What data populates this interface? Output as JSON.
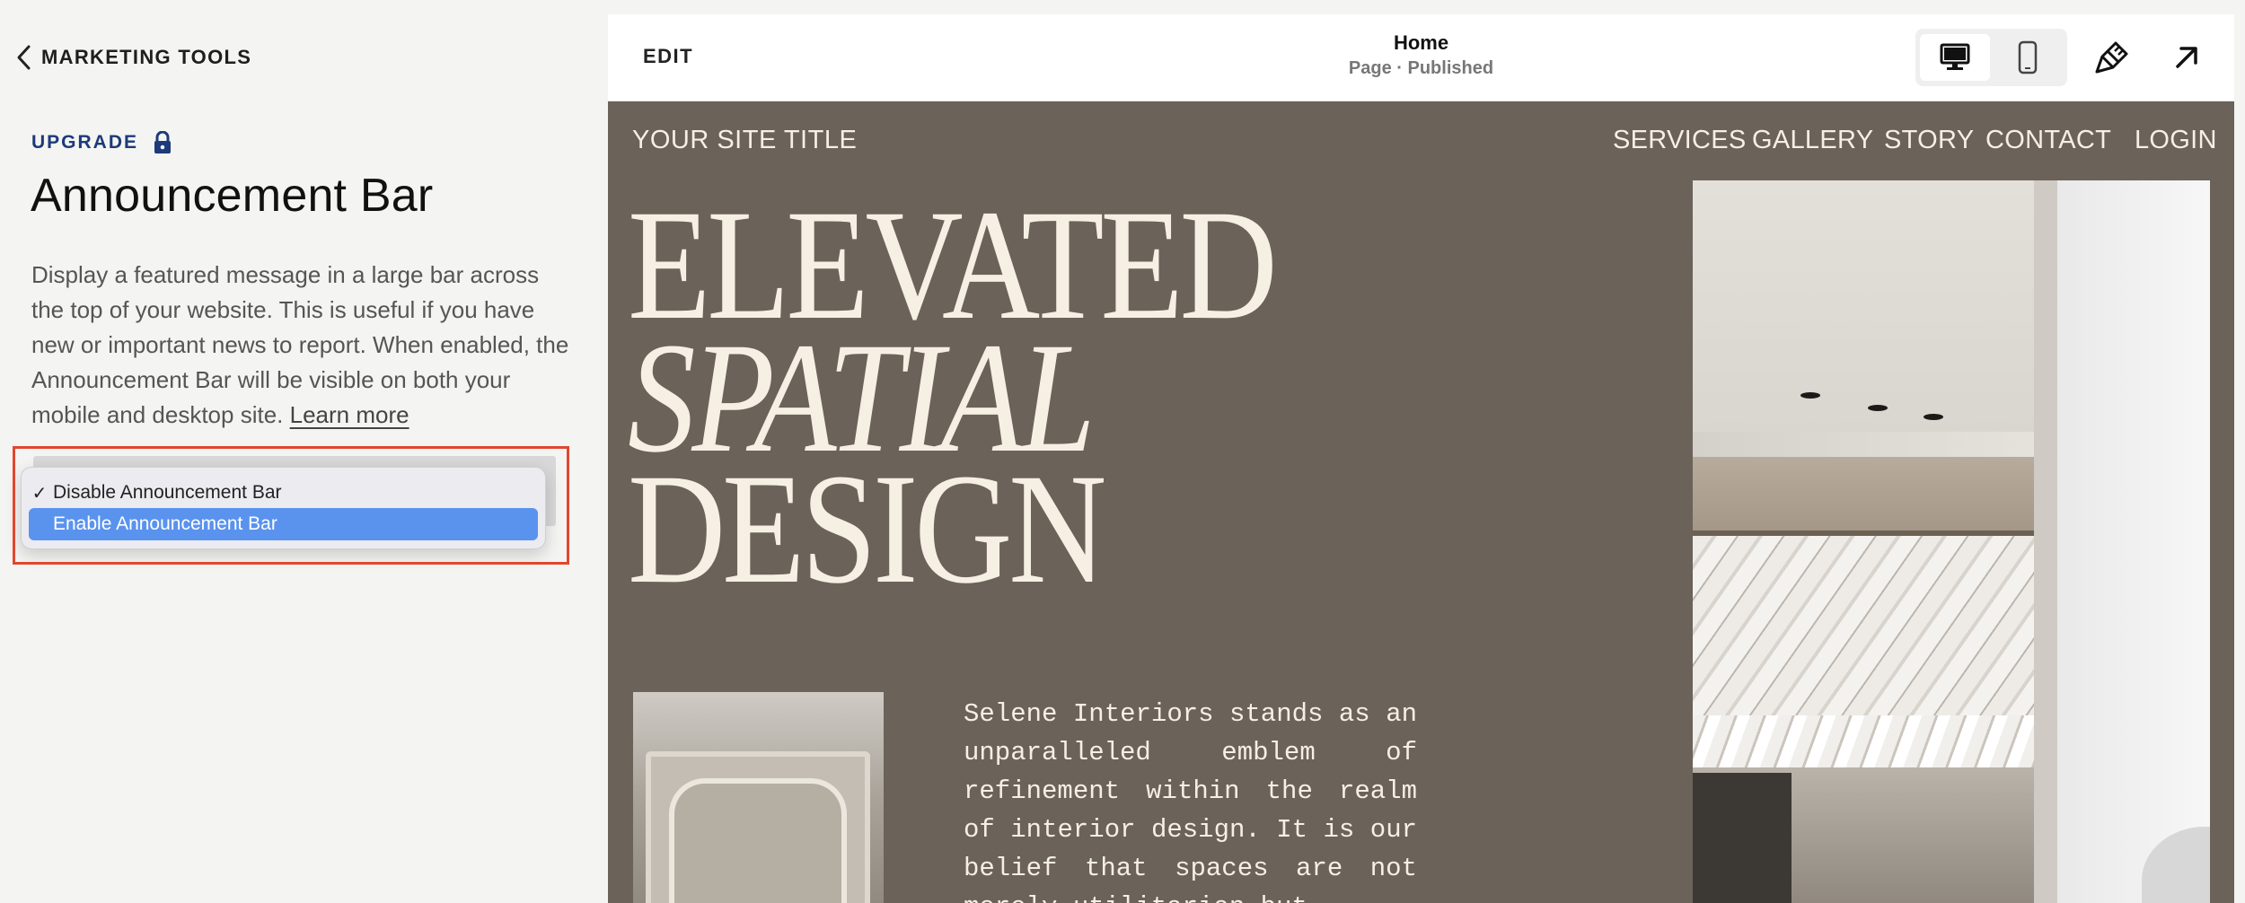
{
  "panel": {
    "back_label": "MARKETING TOOLS",
    "upgrade_label": "UPGRADE",
    "title": "Announcement Bar",
    "description": "Display a featured message in a large bar across the top of your website. This is useful if you have new or important news to report. When enabled, the Announcement Bar will be visible on both your mobile and desktop site.",
    "learn_more": "Learn more",
    "dropdown": {
      "options": [
        {
          "label": "Disable Announcement Bar",
          "checked": true
        },
        {
          "label": "Enable Announcement Bar",
          "highlighted": true
        }
      ],
      "check_glyph": "✓"
    },
    "highlight_color": "#e0472f"
  },
  "editor": {
    "edit_label": "EDIT",
    "page_name": "Home",
    "page_status": "Page · Published",
    "icons": [
      "desktop-icon",
      "mobile-icon",
      "paintbrush-icon",
      "open-external-icon"
    ]
  },
  "site": {
    "title": "YOUR SITE TITLE",
    "nav": [
      "SERVICES",
      "GALLERY",
      "STORY",
      "CONTACT",
      "LOGIN"
    ],
    "hero": [
      "ELEVATED",
      "SPATIAL",
      "DESIGN"
    ],
    "body": "Selene Interiors stands as an unparalleled emblem of refinement within the realm of interior design. It is our belief that spaces are not merely utilitarian but",
    "colors": {
      "background": "#6b625a",
      "text": "#f5efe4"
    }
  }
}
